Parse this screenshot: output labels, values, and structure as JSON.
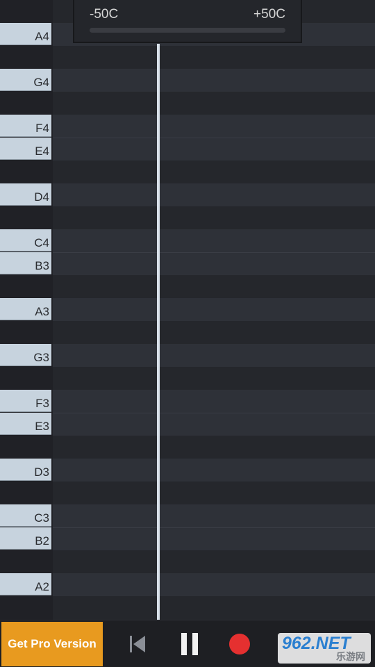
{
  "tuner": {
    "min_label": "-50C",
    "max_label": "+50C"
  },
  "notes": [
    {
      "label": "A4",
      "white": true
    },
    {
      "label": "",
      "white": false
    },
    {
      "label": "G4",
      "white": true
    },
    {
      "label": "",
      "white": false
    },
    {
      "label": "F4",
      "white": true
    },
    {
      "label": "E4",
      "white": true
    },
    {
      "label": "",
      "white": false
    },
    {
      "label": "D4",
      "white": true
    },
    {
      "label": "",
      "white": false
    },
    {
      "label": "C4",
      "white": true
    },
    {
      "label": "B3",
      "white": true
    },
    {
      "label": "",
      "white": false
    },
    {
      "label": "A3",
      "white": true
    },
    {
      "label": "",
      "white": false
    },
    {
      "label": "G3",
      "white": true
    },
    {
      "label": "",
      "white": false
    },
    {
      "label": "F3",
      "white": true
    },
    {
      "label": "E3",
      "white": true
    },
    {
      "label": "",
      "white": false
    },
    {
      "label": "D3",
      "white": true
    },
    {
      "label": "",
      "white": false
    },
    {
      "label": "C3",
      "white": true
    },
    {
      "label": "B2",
      "white": true
    },
    {
      "label": "",
      "white": false
    },
    {
      "label": "A2",
      "white": true
    }
  ],
  "bottom_bar": {
    "pro_label": "Get Pro Version",
    "rewind_icon": "skip-to-start-icon",
    "pause_icon": "pause-icon",
    "record_icon": "record-icon",
    "watermark_main": "962.NET",
    "watermark_sub": "乐游网"
  },
  "colors": {
    "accent": "#e89a1f",
    "record": "#e53030",
    "key": "#c7d3de"
  }
}
